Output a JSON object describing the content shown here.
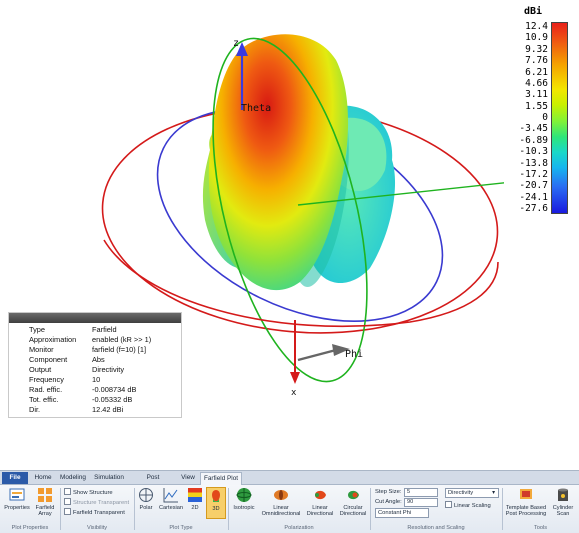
{
  "viewport": {
    "axes": {
      "z": "z",
      "theta": "Theta",
      "phi": "Phi",
      "x": "x"
    }
  },
  "colorbar": {
    "unit": "dBi",
    "ticks": [
      "12.4",
      "10.9",
      "9.32",
      "7.76",
      "6.21",
      "4.66",
      "3.11",
      "1.55",
      "0",
      "-3.45",
      "-6.89",
      "-10.3",
      "-13.8",
      "-17.2",
      "-20.7",
      "-24.1",
      "-27.6"
    ]
  },
  "info_panel": {
    "rows": [
      {
        "key": "Type",
        "value": "Farfield"
      },
      {
        "key": "Approximation",
        "value": "enabled (kR >> 1)"
      },
      {
        "key": "Monitor",
        "value": "farfield (f=10) [1]"
      },
      {
        "key": "Component",
        "value": "Abs"
      },
      {
        "key": "Output",
        "value": "Directivity"
      },
      {
        "key": "Frequency",
        "value": "10"
      },
      {
        "key": "Rad. effic.",
        "value": "-0.008734 dB"
      },
      {
        "key": "Tot. effic.",
        "value": "-0.05332 dB"
      },
      {
        "key": "Dir.",
        "value": "12.42 dBi"
      }
    ]
  },
  "ribbon": {
    "tabs": [
      "File",
      "Home",
      "Modeling",
      "Simulation",
      "Post Processing",
      "View",
      "Farfield Plot"
    ],
    "active_tab": "Farfield Plot",
    "buttons": {
      "properties": "Properties",
      "farfield_array": "Farfield Array",
      "polar": "Polar",
      "cartesian": "Cartesian",
      "2d": "2D",
      "3d": "3D",
      "isotropic": "Isotropic",
      "linear_omni": "Linear Omnidirectional",
      "linear_dir": "Linear Directional",
      "circular_dir": "Circular Directional",
      "template": "Template Based Post Processing",
      "cylinder": "Cylinder Scan"
    },
    "checkboxes": {
      "show_structure": "Show Structure",
      "structure_transparent": "Structure Transparent",
      "farfield_transparent": "Farfield Transparent",
      "linear_scaling": "Linear Scaling"
    },
    "fields": {
      "step_size_label": "Step Size:",
      "step_size_value": "5",
      "cut_angle_label": "Cut Angle:",
      "cut_angle_value": "90",
      "cut_mode": "Constant Phi",
      "quantity": "Directivity"
    },
    "groups": {
      "plot_properties": "Plot Properties",
      "visibility": "Visibility",
      "plot_type": "Plot Type",
      "polarization": "Polarization",
      "resolution": "Resolution and Scaling",
      "tools": "Tools"
    }
  }
}
